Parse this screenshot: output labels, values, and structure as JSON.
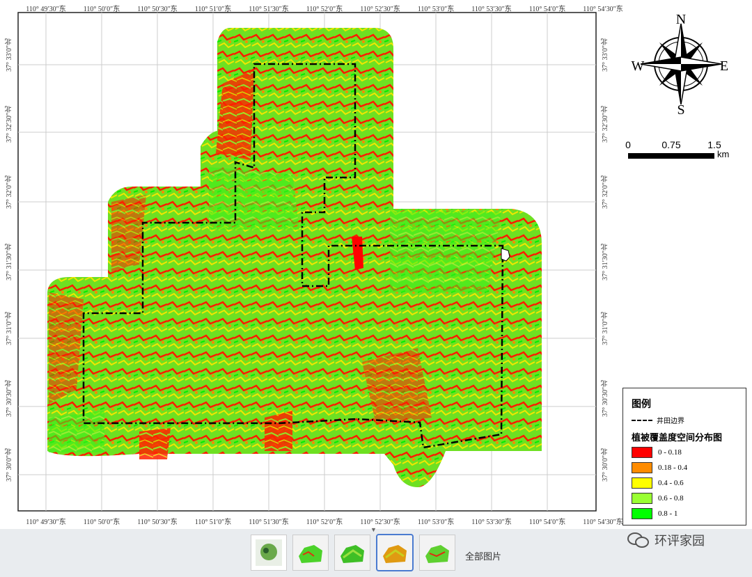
{
  "map": {
    "top_ticks": [
      "110° 49′30″东",
      "110° 50′0″东",
      "110° 50′30″东",
      "110° 51′0″东",
      "110° 51′30″东",
      "110° 52′0″东",
      "110° 52′30″东",
      "110° 53′0″东",
      "110° 53′30″东",
      "110° 54′0″东",
      "110° 54′30″东"
    ],
    "bottom_ticks": [
      "110° 49′30″东",
      "110° 50′0″东",
      "110° 50′30″东",
      "110° 51′0″东",
      "110° 51′30″东",
      "110° 52′0″东",
      "110° 52′30″东",
      "110° 53′0″东",
      "110° 53′30″东",
      "110° 54′0″东",
      "110° 54′30″东"
    ],
    "side_ticks": [
      "37° 33′0″北",
      "37° 32′30″北",
      "37° 32′0″北",
      "37° 31′30″北",
      "37° 31′0″北",
      "37° 30′30″北",
      "37° 30′0″北"
    ]
  },
  "compass": {
    "n": "N",
    "s": "S",
    "e": "E",
    "w": "W"
  },
  "scale_bar": {
    "labels": [
      "0",
      "0.75",
      "1.5"
    ],
    "unit": "km"
  },
  "legend": {
    "title": "图例",
    "boundary_label": "井田边界",
    "subtitle": "植被覆盖度空间分布图",
    "classes": [
      {
        "label": "0 - 0.18",
        "color": "#ff0000"
      },
      {
        "label": "0.18 - 0.4",
        "color": "#ff8c00"
      },
      {
        "label": "0.4 - 0.6",
        "color": "#ffff00"
      },
      {
        "label": "0.6 - 0.8",
        "color": "#99ff33"
      },
      {
        "label": "0.8 - 1",
        "color": "#00ff00"
      }
    ]
  },
  "viewer": {
    "all_pictures_label": "全部图片"
  },
  "watermark": {
    "text": "环评家园"
  }
}
